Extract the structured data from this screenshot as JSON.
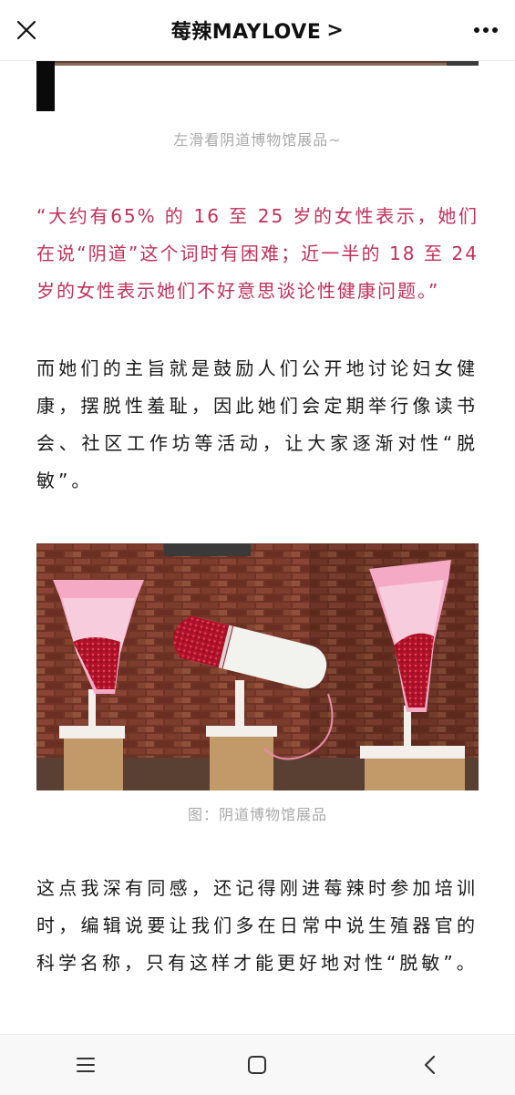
{
  "header": {
    "title": "莓辣MAYLOVE",
    "title_arrow": ">",
    "close_icon": "close-icon",
    "more_icon": "more-dots-icon"
  },
  "article": {
    "caption1": "左滑看阴道博物馆展品~",
    "quote": "“大约有65% 的 16 至 25 岁的女性表示，她们在说“阴道”这个词时有困难；近一半的 18 至 24 岁的女性表示她们不好意思谈论性健康问题。”",
    "para1": "而她们的主旨就是鼓励人们公开地讨论妇女健康，摆脱性羞耻，因此她们会定期举行像读书会、社区工作坊等活动，让大家逐渐对性“脱敏”。",
    "caption2": "图：阴道博物馆展品",
    "para2": "这点我深有同感，还记得刚进莓辣时参加培训时，编辑说要让我们多在日常中说生殖器官的科学名称，只有这样才能更好地对性“脱敏”。"
  },
  "colors": {
    "quote": "#c1305a",
    "caption": "#a9a9a9",
    "brick": "#7a3b2b"
  },
  "navbar": {
    "menu_icon": "menu-icon",
    "home_icon": "home-square-icon",
    "back_icon": "back-chevron-icon"
  }
}
